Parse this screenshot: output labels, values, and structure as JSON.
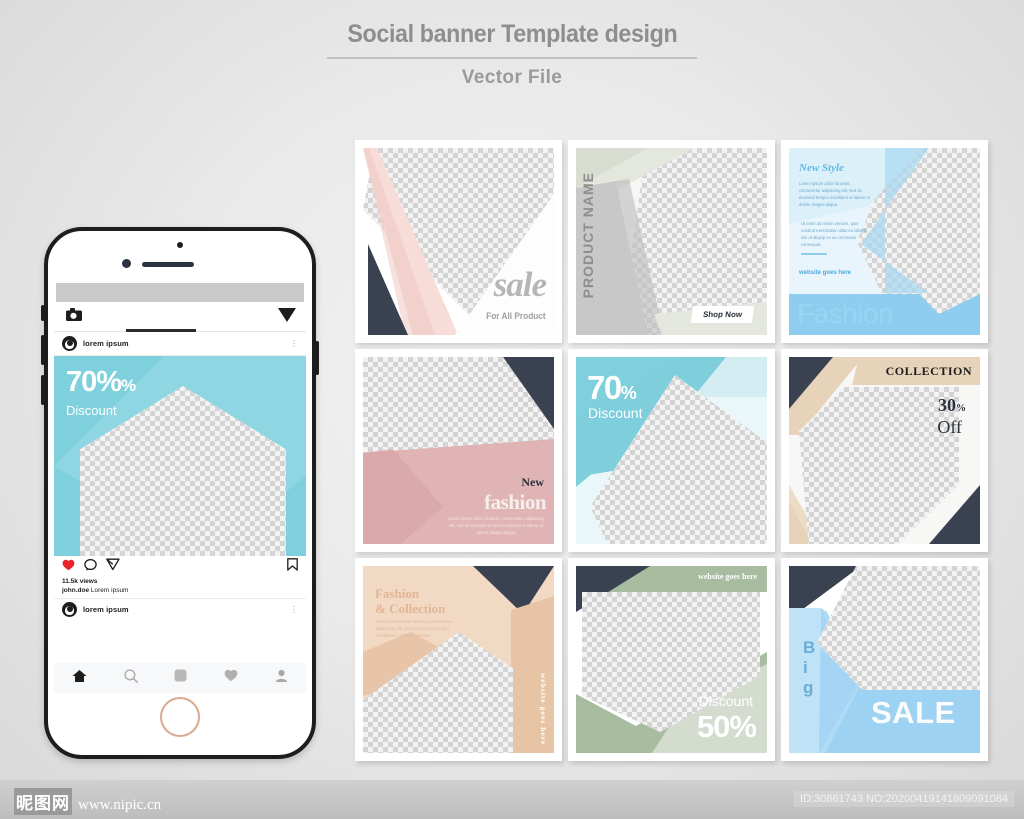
{
  "header": {
    "title": "Social banner Template design",
    "subtitle": "Vector File"
  },
  "phone": {
    "post_user": "lorem ipsum",
    "post_user2": "lorem ipsum",
    "views": "11.5k views",
    "caption_user": "john.doe",
    "caption_text": "Lorem ipsum",
    "dots": "⋮",
    "post_banner": {
      "headline": "70%",
      "pct": "%",
      "sub": "Discount"
    },
    "icons": {
      "camera": "camera-icon",
      "send": "send-icon",
      "like": "heart-icon",
      "comment": "comment-icon",
      "share": "share-icon",
      "bookmark": "bookmark-icon",
      "home": "home-icon",
      "search": "search-icon",
      "reels": "reels-icon",
      "activity": "heart-nav-icon",
      "profile": "profile-icon"
    }
  },
  "banners": [
    {
      "id": "banner-sale",
      "title": "sale",
      "subtitle": "For All Product",
      "colors": {
        "accent": "#f7dcd8",
        "dark": "#3a4150",
        "bg": "#ffffff"
      }
    },
    {
      "id": "banner-product-name",
      "title": "PRODUCT NAME",
      "button": "Shop Now",
      "colors": {
        "accent": "#e4e7dd",
        "gray": "#c8c8c8",
        "bg": "#f6f6f4"
      }
    },
    {
      "id": "banner-new-style",
      "title": "New Style",
      "body1": "Lorem ipsum dolor sit amet, consectetur adipiscing elit, sed do eiusmod tempor incididunt ut labore et dolore magna aliqua.",
      "body2": "Ut enim ad minim veniam, quis nostrud exercitation ullamco laboris nisi ut aliquip ex ea commodo consequat.",
      "website": "website goes here",
      "big": "Fashion",
      "colors": {
        "accent": "#8ecdf0",
        "light": "#e9f5fc",
        "bg": "#ddeef9"
      }
    },
    {
      "id": "banner-new-fashion",
      "title": "New",
      "subtitle": "fashion",
      "body": "Lorem ipsum dolor sit amet, consectetur adipiscing elit, sed do eiusmod tempor incididunt ut labore et dolore magna aliqua",
      "colors": {
        "accent": "#e0b4b4",
        "dark": "#3a4150",
        "bg": "#ffffff"
      }
    },
    {
      "id": "banner-70-discount",
      "title": "70",
      "pct": "%",
      "subtitle": "Discount",
      "colors": {
        "accent": "#7fd0dd",
        "light": "#d9eff5",
        "bg": "#eaf7fa"
      }
    },
    {
      "id": "banner-collection",
      "title": "COLLECTION",
      "discount": "30",
      "pct": "%",
      "subtitle": "Off",
      "colors": {
        "accent": "#e6d3ba",
        "dark": "#3a4150",
        "bg": "#f7f7f5"
      }
    },
    {
      "id": "banner-fashion-collection",
      "title": "Fashion",
      "title2": "& Collection",
      "body": "Lorem ipsum dolor sit amet, consectetur adipiscing elit, sed do eiusmod tempor incididunt ut labore et dolore.",
      "website": "website goes here",
      "colors": {
        "accent": "#e8c4a6",
        "dark": "#3a4150",
        "bg": "#f2d9c3"
      }
    },
    {
      "id": "banner-discount-50",
      "website": "website goes here",
      "subtitle": "Discount",
      "title": "50",
      "pct": "%",
      "colors": {
        "accent": "#a8bca0",
        "dark": "#3a4150",
        "bg": "#ffffff"
      }
    },
    {
      "id": "banner-big-sale",
      "letters": [
        "B",
        "i",
        "g"
      ],
      "title": "SALE",
      "colors": {
        "accent": "#9ed2f2",
        "light": "#bfe2f7",
        "dark": "#3a4150"
      }
    }
  ],
  "footer": {
    "logo_cn": "昵图网",
    "url": "www.nipic.cn",
    "id_text": "ID:30861743 NO:20200419141809091084"
  }
}
